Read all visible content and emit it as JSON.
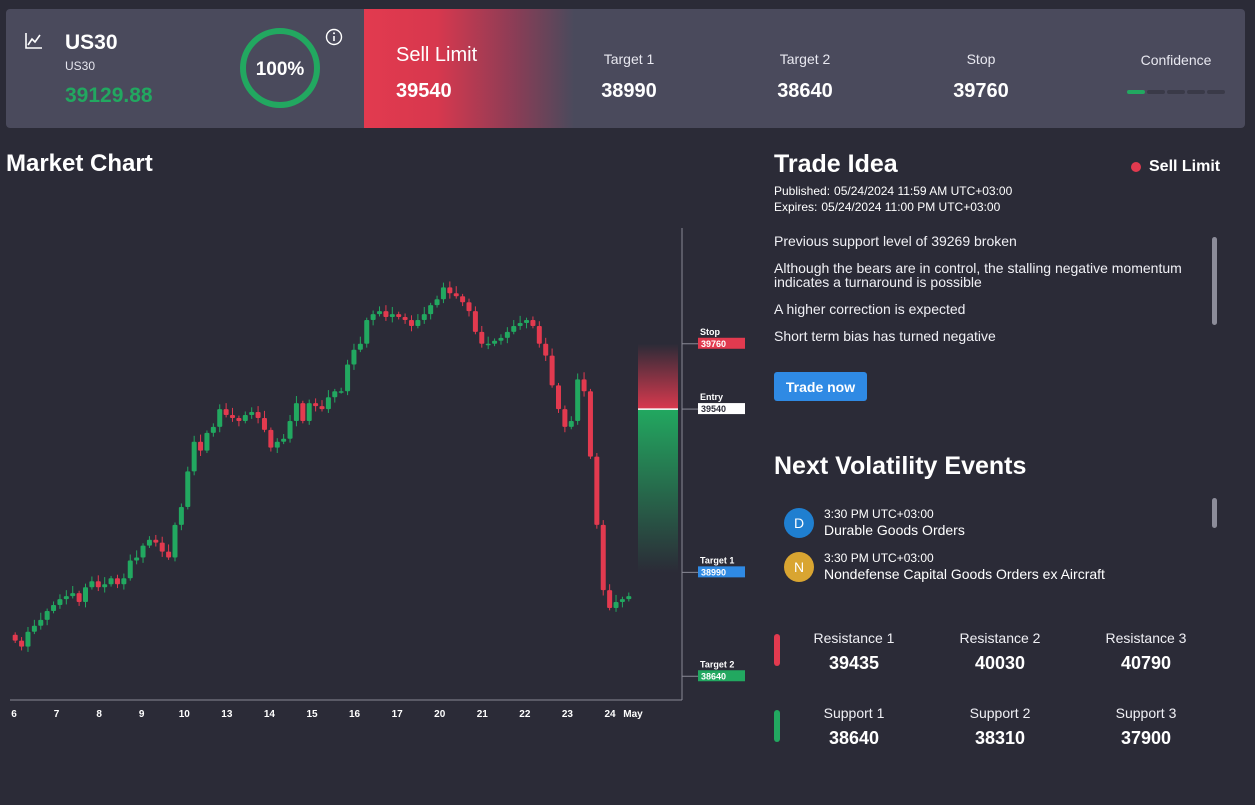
{
  "header": {
    "symbol": "US30",
    "symbol_sub": "US30",
    "price": "39129.88",
    "confidence_pct": "100%",
    "order_type": "Sell Limit",
    "entry": "39540",
    "target1_label": "Target 1",
    "target1": "38990",
    "target2_label": "Target 2",
    "target2": "38640",
    "stop_label": "Stop",
    "stop": "39760",
    "confidence_label": "Confidence",
    "confidence_level": 1,
    "confidence_segments": 5
  },
  "market_chart": {
    "title": "Market Chart"
  },
  "trade_idea": {
    "title": "Trade Idea",
    "badge": "Sell Limit",
    "published_label": "Published:",
    "published": "05/24/2024 11:59 AM UTC+03:00",
    "expires_label": "Expires:",
    "expires": "05/24/2024 11:00 PM UTC+03:00",
    "bullets": [
      "Previous support level of 39269 broken",
      "Although the bears are in control, the stalling negative momentum indicates a turnaround is possible",
      "A higher correction is expected",
      "Short term bias has turned negative"
    ],
    "button": "Trade now"
  },
  "volatility": {
    "title": "Next Volatility Events",
    "events": [
      {
        "letter": "D",
        "time": "3:30 PM UTC+03:00",
        "name": "Durable Goods Orders",
        "color": "#1f7fd0"
      },
      {
        "letter": "N",
        "time": "3:30 PM UTC+03:00",
        "name": "Nondefense Capital Goods Orders ex Aircraft",
        "color": "#d9a531"
      }
    ]
  },
  "levels": {
    "resistance": [
      {
        "label": "Resistance 1",
        "value": "39435"
      },
      {
        "label": "Resistance 2",
        "value": "40030"
      },
      {
        "label": "Resistance 3",
        "value": "40790"
      }
    ],
    "support": [
      {
        "label": "Support 1",
        "value": "38640"
      },
      {
        "label": "Support 2",
        "value": "38310"
      },
      {
        "label": "Support 3",
        "value": "37900"
      }
    ],
    "resistance_color": "#e23a4f",
    "support_color": "#22a860"
  },
  "chart_data": {
    "type": "candlestick",
    "x_tick_labels": [
      "6",
      "7",
      "8",
      "9",
      "10",
      "13",
      "14",
      "15",
      "16",
      "17",
      "20",
      "21",
      "22",
      "23",
      "24",
      "May"
    ],
    "ylim": [
      38560,
      40150
    ],
    "markers": [
      {
        "label": "Stop",
        "value": "39760",
        "color": "#e23a4f"
      },
      {
        "label": "Entry",
        "value": "39540",
        "color": "#ffffff"
      },
      {
        "label": "Target 1",
        "value": "38990",
        "color": "#2f8ae4"
      },
      {
        "label": "Target 2",
        "value": "38640",
        "color": "#22a860"
      }
    ],
    "entry_line": 39540,
    "stop_zone": [
      39540,
      39760
    ],
    "target_zone": [
      38990,
      39540
    ],
    "up_color": "#22a860",
    "down_color": "#e23a4f",
    "candles_close": [
      38760,
      38740,
      38790,
      38810,
      38830,
      38860,
      38880,
      38900,
      38910,
      38920,
      38890,
      38940,
      38960,
      38940,
      38950,
      38970,
      38950,
      38970,
      39030,
      39040,
      39080,
      39100,
      39090,
      39060,
      39040,
      39150,
      39210,
      39330,
      39430,
      39400,
      39460,
      39480,
      39540,
      39520,
      39510,
      39500,
      39520,
      39530,
      39510,
      39470,
      39410,
      39430,
      39440,
      39500,
      39560,
      39500,
      39560,
      39550,
      39540,
      39580,
      39600,
      39600,
      39690,
      39740,
      39760,
      39840,
      39860,
      39870,
      39850,
      39860,
      39850,
      39840,
      39820,
      39840,
      39860,
      39890,
      39910,
      39950,
      39930,
      39920,
      39900,
      39870,
      39800,
      39760,
      39760,
      39770,
      39780,
      39800,
      39820,
      39830,
      39840,
      39820,
      39760,
      39720,
      39620,
      39540,
      39480,
      39500,
      39640,
      39600,
      39380,
      39150,
      38930,
      38870,
      38890,
      38900,
      38910
    ]
  }
}
